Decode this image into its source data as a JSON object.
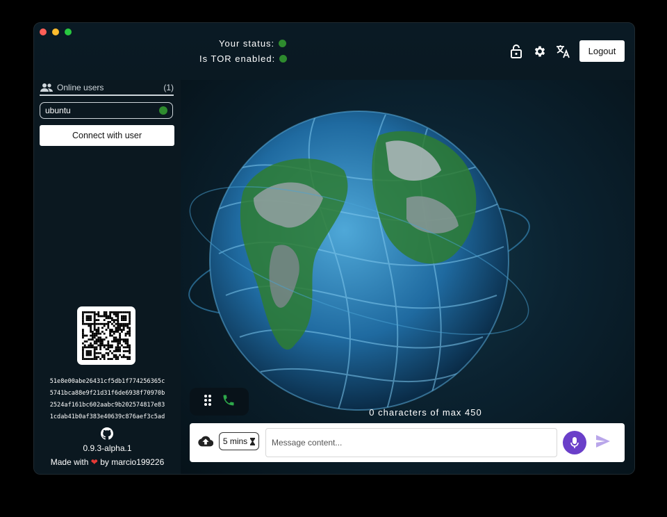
{
  "header": {
    "status_label": "Your status:",
    "tor_label": "Is TOR enabled:",
    "logout_label": "Logout",
    "icons": [
      "unlock-icon",
      "gear-icon",
      "translate-icon"
    ]
  },
  "sidebar": {
    "online_users_label": "Online users",
    "online_count": "(1)",
    "users": [
      {
        "name": "ubuntu",
        "status": "online"
      }
    ],
    "connect_label": "Connect with user",
    "hash_lines": [
      "51e8e00abe26431cf5db1f774256365c",
      "5741bca88e9f21d31f6de6938f70970b",
      "2524af161bc602aabc9b202574817e83",
      "1cdab41b0af383e40639c876aef3c5ad"
    ],
    "version": "0.9.3-alpha.1",
    "made_with_prefix": "Made with",
    "made_with_suffix": "by marcio199226"
  },
  "chat": {
    "chars_counter": "0 characters of max 450",
    "timer_label": "5 mins",
    "message_placeholder": "Message content..."
  },
  "colors": {
    "status_online": "#2e8b2e",
    "mic_button": "#6a3fc9",
    "send_icon": "#b9a6ea",
    "heart": "#e53935"
  }
}
